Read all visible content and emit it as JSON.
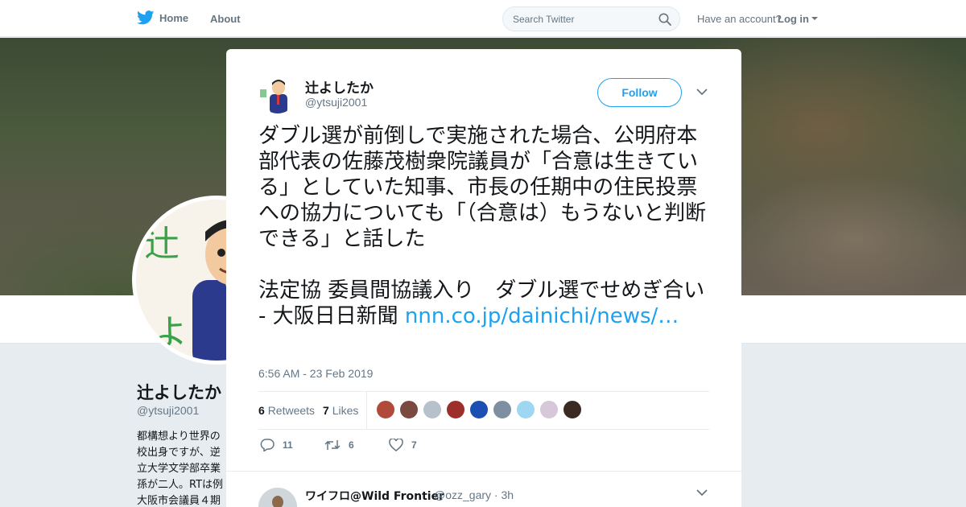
{
  "nav": {
    "home_label": "Home",
    "about_label": "About",
    "search_placeholder": "Search Twitter",
    "have_account": "Have an account?",
    "login_label": "Log in"
  },
  "profile": {
    "name": "辻よしたか",
    "handle": "@ytsuji2001",
    "bio_lines": [
      "都構想より世界の",
      "校出身ですが、逆",
      "立大学文学部卒業",
      "孫が二人。RTは例",
      "大阪市会議員４期"
    ]
  },
  "tweet": {
    "author_name": "辻よしたか",
    "author_handle": "@ytsuji2001",
    "follow_label": "Follow",
    "text": "ダブル選が前倒しで実施された場合、公明府本部代表の佐藤茂樹衆院議員が「合意は生きている」としていた知事、市長の任期中の住民投票への協力についても「（合意は）もうないと判断できる」と話した\n\n法定協 委員間協議入り　ダブル選でせめぎ合い - 大阪日日新聞 ",
    "link_text": "nnn.co.jp/dainichi/news/…",
    "timestamp": "6:56 AM - 23 Feb 2019",
    "retweets_count": "6",
    "retweets_label": "Retweets",
    "likes_count": "7",
    "likes_label": "Likes",
    "reply_count": "11",
    "retweet_action_count": "6",
    "like_action_count": "7",
    "retweeter_face_colors": [
      "#b04a3a",
      "#7a4a40",
      "#b7c1cc",
      "#9c2f2a",
      "#1c4fb3",
      "#7d8fa0",
      "#9fd6f2",
      "#d6c7d9",
      "#3a2a22"
    ]
  },
  "reply": {
    "author_name": "ワイフロ@Wild Frontier",
    "author_handle": "@ozz_gary · 3h"
  },
  "colors": {
    "accent": "#1da1f2",
    "link": "#1da1f2",
    "muted": "#657786"
  }
}
